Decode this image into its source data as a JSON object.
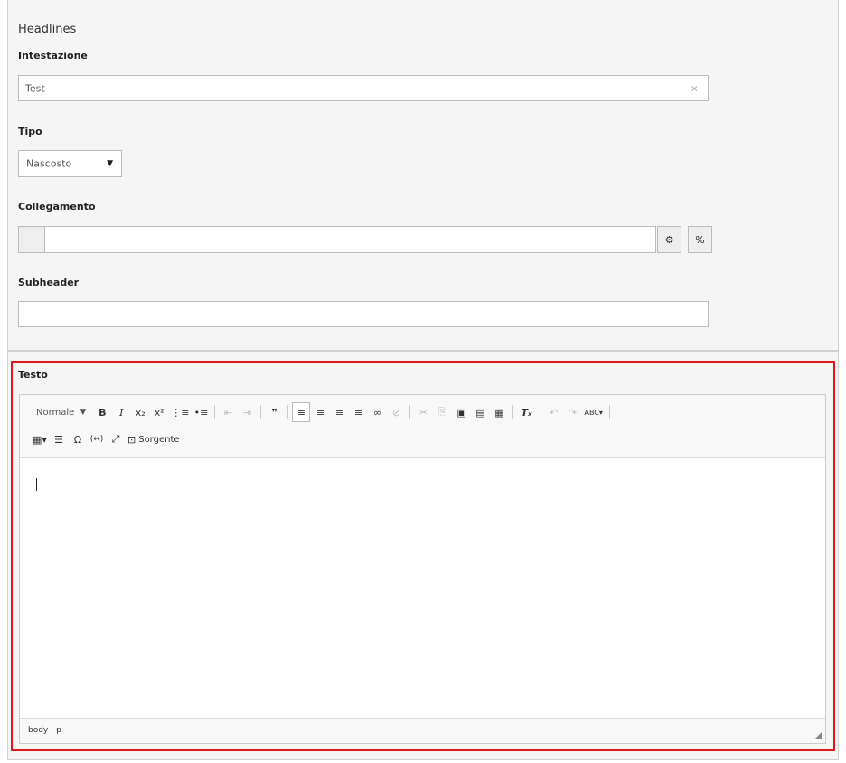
{
  "header": {
    "section_title": "Headlines"
  },
  "fields": {
    "intestazione": {
      "label": "Intestazione",
      "value": "Test",
      "clear": "×"
    },
    "tipo": {
      "label": "Tipo",
      "value": "Nascosto",
      "chevron": "▼"
    },
    "collegamento": {
      "label": "Collegamento",
      "value": "",
      "browse_icon": "⚙",
      "link_icon": "%"
    },
    "subheader": {
      "label": "Subheader",
      "value": ""
    }
  },
  "rte": {
    "label": "Testo",
    "format_value": "Normale",
    "format_arrow": "▼",
    "toolbar": {
      "bold": "B",
      "italic": "I",
      "subscript": "x₂",
      "superscript": "x²",
      "numbered_list": "⋮≡",
      "bulleted_list": "•≡",
      "outdent": "⇤",
      "indent": "⇥",
      "blockquote": "❞",
      "align_left": "≡",
      "align_center": "≡",
      "align_right": "≡",
      "align_justify": "≡",
      "link": "∞",
      "unlink": "⊘",
      "cut": "✂",
      "copy": "⎘",
      "paste": "▣",
      "paste_text": "▤",
      "paste_word": "▦",
      "remove_format": "Tₓ",
      "undo": "↶",
      "redo": "↷",
      "spellcheck": "ABC▾",
      "table": "▦▾",
      "hr": "☰",
      "special_char": "Ω",
      "anchor": "(↔)",
      "maximize": "⤢",
      "source_icon": "⊡",
      "source_label": "Sorgente"
    },
    "path": [
      "body",
      "p"
    ]
  }
}
